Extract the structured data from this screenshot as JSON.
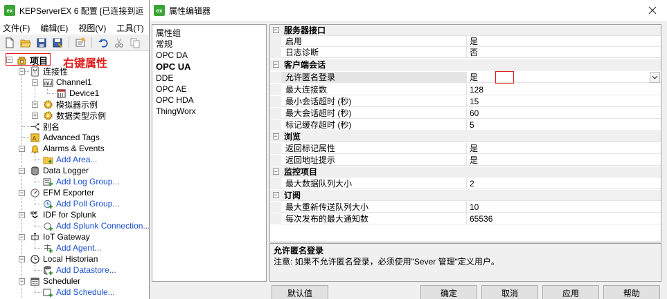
{
  "main_window": {
    "title": "KEPServerEX 6 配置 [已连接到运",
    "logo": "ex",
    "menu": [
      "文件(F)",
      "编辑(E)",
      "视图(V)",
      "工具(T)"
    ],
    "toolbar_icons": [
      "new-file-icon",
      "open-folder-icon",
      "save-icon",
      "save-as-icon",
      "properties-icon",
      "undo-icon",
      "cut-icon",
      "copy-icon"
    ]
  },
  "tree": {
    "root": "项目",
    "annotation": "右键属性",
    "items": [
      {
        "label": "连接性"
      },
      {
        "label": "Channel1"
      },
      {
        "label": "Device1"
      },
      {
        "label": "模拟器示例"
      },
      {
        "label": "数据类型示例"
      },
      {
        "label": "别名"
      },
      {
        "label": "Advanced Tags"
      },
      {
        "label": "Alarms & Events"
      },
      {
        "label": "Add Area..."
      },
      {
        "label": "Data Logger"
      },
      {
        "label": "Add Log Group..."
      },
      {
        "label": "EFM Exporter"
      },
      {
        "label": "Add Poll Group..."
      },
      {
        "label": "IDF for Splunk"
      },
      {
        "label": "Add Splunk Connection..."
      },
      {
        "label": "IoT Gateway"
      },
      {
        "label": "Add Agent..."
      },
      {
        "label": "Local Historian"
      },
      {
        "label": "Add Datastore..."
      },
      {
        "label": "Scheduler"
      },
      {
        "label": "Add Schedule..."
      }
    ]
  },
  "dialog": {
    "title": "属性编辑器",
    "logo": "ex",
    "groups_header": "属性组",
    "groups": [
      "常规",
      "OPC DA",
      "OPC UA",
      "DDE",
      "OPC AE",
      "OPC HDA",
      "ThingWorx"
    ],
    "selected_group": "OPC UA",
    "properties": [
      {
        "category": "服务器接口"
      },
      {
        "name": "启用",
        "value": "是"
      },
      {
        "name": "日志诊断",
        "value": "否"
      },
      {
        "category": "客户端会话"
      },
      {
        "name": "允许匿名登录",
        "value": "是",
        "selected": true
      },
      {
        "name": "最大连接数",
        "value": "128"
      },
      {
        "name": "最小会话超时 (秒)",
        "value": "15"
      },
      {
        "name": "最大会话超时 (秒)",
        "value": "60"
      },
      {
        "name": "标记缓存超时 (秒)",
        "value": "5"
      },
      {
        "category": "浏览"
      },
      {
        "name": "返回标记属性",
        "value": "是"
      },
      {
        "name": "返回地址提示",
        "value": "是"
      },
      {
        "category": "监控项目"
      },
      {
        "name": "最大数据队列大小",
        "value": "2"
      },
      {
        "category": "订阅"
      },
      {
        "name": "最大重新传送队列大小",
        "value": "10"
      },
      {
        "name": "每次发布的最大通知数",
        "value": "65536"
      }
    ],
    "description": {
      "title": "允许匿名登录",
      "text": "注意: 如果不允许匿名登录，必须使用\"Sever 管理\"定义用户。"
    },
    "buttons": {
      "defaults": "默认值",
      "ok": "确定",
      "cancel": "取消",
      "apply": "应用",
      "help": "帮助"
    }
  },
  "colors": {
    "highlight_red": "#e02020",
    "link_blue": "#1a4fcc",
    "logo_green": "#3aa534"
  }
}
